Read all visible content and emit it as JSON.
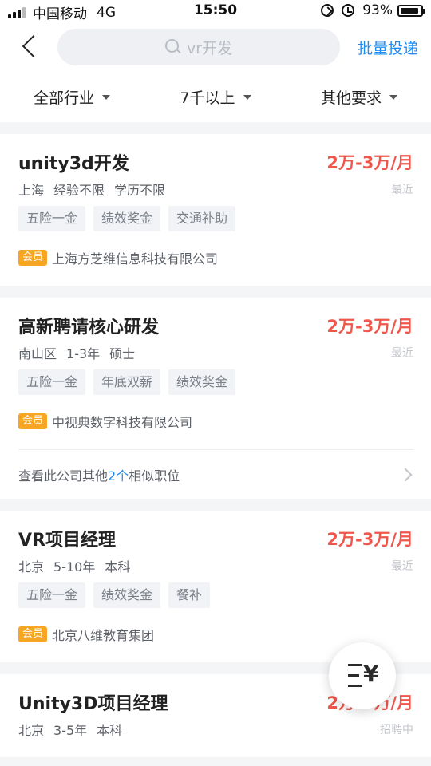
{
  "status_bar": {
    "carrier": "中国移动",
    "network": "4G",
    "time": "15:50",
    "battery": "93%",
    "battery_level": 0.93
  },
  "nav": {
    "search_placeholder": "vr开发",
    "batch_label": "批量投递"
  },
  "filters": [
    {
      "label": "全部行业"
    },
    {
      "label": "7千以上"
    },
    {
      "label": "其他要求"
    }
  ],
  "jobs": [
    {
      "title": "unity3d开发",
      "salary": "2万-3万/月",
      "location": "上海",
      "experience": "经验不限",
      "education": "学历不限",
      "time": "最近",
      "tags": [
        "五险一金",
        "绩效奖金",
        "交通补助"
      ],
      "badge": "会员",
      "company": "上海方芝维信息科技有限公司"
    },
    {
      "title": "高新聘请核心研发",
      "salary": "2万-3万/月",
      "location": "南山区",
      "experience": "1-3年",
      "education": "硕士",
      "time": "最近",
      "tags": [
        "五险一金",
        "年底双薪",
        "绩效奖金"
      ],
      "badge": "会员",
      "company": "中视典数字科技有限公司",
      "similar": {
        "prefix": "查看此公司其他",
        "count": "2个",
        "suffix": "相似职位"
      }
    },
    {
      "title": "VR项目经理",
      "salary": "2万-3万/月",
      "location": "北京",
      "experience": "5-10年",
      "education": "本科",
      "time": "最近",
      "tags": [
        "五险一金",
        "绩效奖金",
        "餐补"
      ],
      "badge": "会员",
      "company": "北京八维教育集团"
    },
    {
      "title": "Unity3D项目经理",
      "salary": "2万-3万/月",
      "location": "北京",
      "experience": "3-5年",
      "education": "本科",
      "time": "招聘中"
    }
  ],
  "icons": {
    "back": "chevron-left-icon",
    "search": "search-icon",
    "filter": "caret-down-icon",
    "float": "salary-filter-icon"
  },
  "colors": {
    "accent": "#1f8bf0",
    "salary": "#f0574c",
    "badge": "#f6a623"
  }
}
